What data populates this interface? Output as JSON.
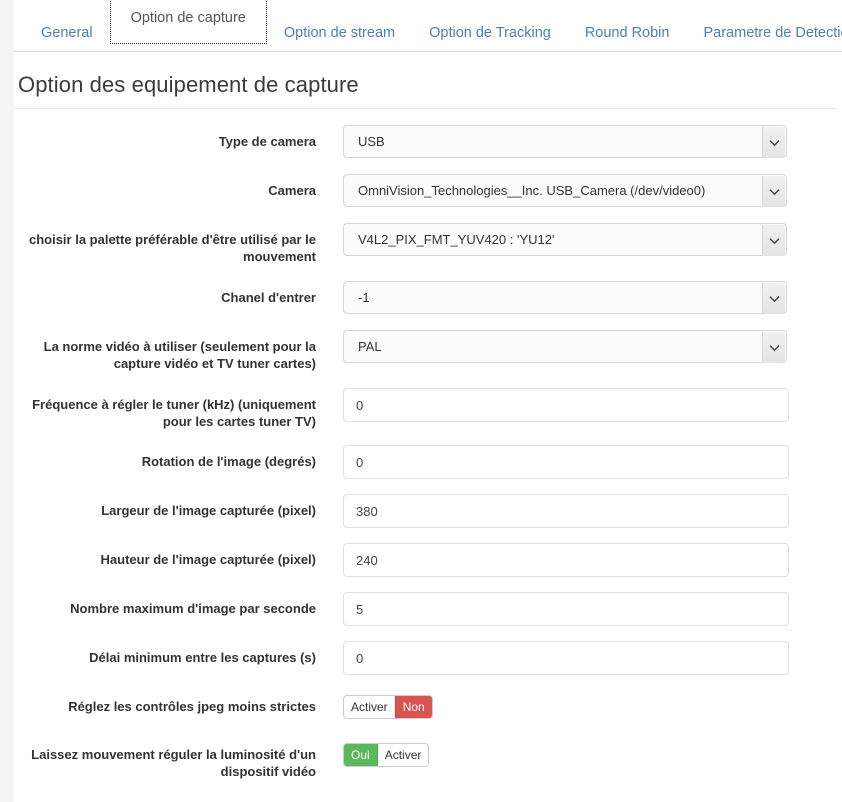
{
  "tabs": [
    {
      "label": "General",
      "active": false
    },
    {
      "label": "Option de capture",
      "active": true
    },
    {
      "label": "Option de stream",
      "active": false
    },
    {
      "label": "Option de Tracking",
      "active": false
    },
    {
      "label": "Round Robin",
      "active": false
    },
    {
      "label": "Parametre de Detection",
      "active": false
    }
  ],
  "heading": "Option des equipement de capture",
  "fields": {
    "camera_type": {
      "label": "Type de camera",
      "value": "USB"
    },
    "camera": {
      "label": "Camera",
      "value": "OmniVision_Technologies__Inc. USB_Camera (/dev/video0)"
    },
    "palette": {
      "label": "choisir la palette préférable d'être utilisé par le mouvement",
      "value": "V4L2_PIX_FMT_YUV420 : 'YU12'"
    },
    "input_channel": {
      "label": "Chanel d'entrer",
      "value": "-1"
    },
    "video_norm": {
      "label": "La norme vidéo à utiliser (seulement pour la capture vidéo et TV tuner cartes)",
      "value": "PAL"
    },
    "tuner_frequency": {
      "label": "Fréquence à régler le tuner (kHz) (uniquement pour les cartes tuner TV)",
      "value": "0",
      "placeholder": ""
    },
    "rotation": {
      "label": "Rotation de l'image (degrés)",
      "value": "0",
      "placeholder": ""
    },
    "width": {
      "label": "Largeur de l'image capturée (pixel)",
      "value": "380",
      "placeholder": ""
    },
    "height": {
      "label": "Hauteur de l'image capturée (pixel)",
      "value": "240",
      "placeholder": ""
    },
    "max_fps": {
      "label": "Nombre maximum d'image par seconde",
      "value": "5",
      "placeholder": ""
    },
    "min_delay": {
      "label": "Délai minimum entre les captures (s)",
      "value": "0",
      "placeholder": ""
    },
    "jpeg_relaxed": {
      "label": "Réglez les contrôles jpeg moins strictes",
      "option_off": "Activer",
      "option_on": "Non",
      "selected": "Non"
    },
    "auto_brightness": {
      "label": "Laissez mouvement réguler la luminosité d'un dispositif vidéo",
      "option_on": "Oui",
      "option_off": "Activer",
      "selected": "Oui"
    }
  },
  "icons": {
    "dropdown": "chevron-down-icon"
  },
  "colors": {
    "link": "#4b7fbd",
    "danger": "#d9534f",
    "success": "#5cb85c",
    "text": "#333333",
    "border": "#dddddd"
  }
}
